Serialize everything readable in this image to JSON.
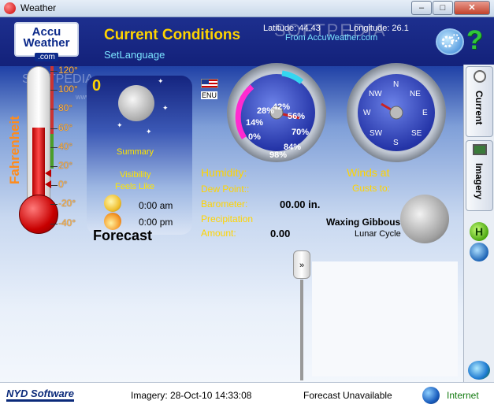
{
  "window": {
    "title": "Weather",
    "minimize_label": "–",
    "maximize_label": "□",
    "close_label": "✕"
  },
  "logo": {
    "line1": "Accu",
    "line2": "Weather",
    "line3": ".com"
  },
  "header": {
    "title": "Current Conditions",
    "set_language": "SetLanguage",
    "latitude": "Latitude: 44.43",
    "longitude": "Longitude: 26.1",
    "source": "From AccuWeather.com",
    "help_label": "?"
  },
  "thermometer": {
    "unit_label": "Fahrenheit",
    "scale": [
      "120°",
      "100°",
      "80°",
      "60°",
      "40°",
      "20°",
      "0°",
      "-20°",
      "-40°"
    ],
    "level_marker_value": 0
  },
  "summary_panel": {
    "temperature": "0",
    "summary_label": "Summary",
    "visibility_label": "Visibility",
    "feels_like_label": "Feels Like",
    "sunrise": "0:00 am",
    "sunset": "0:00 pm",
    "forecast_label": "Forecast"
  },
  "language": {
    "code": "ENU"
  },
  "humidity_gauge": {
    "labels": [
      "0%",
      "14%",
      "28%",
      "42%",
      "56%",
      "70%",
      "84%",
      "98%"
    ],
    "value_percent": 0
  },
  "wind_gauge": {
    "labels": [
      "N",
      "NE",
      "E",
      "SE",
      "S",
      "SW",
      "W",
      "NW"
    ]
  },
  "conditions": {
    "humidity_label": "Humidity:",
    "dew_point_label": "Dew Point::",
    "barometer_label": "Barometer:",
    "barometer_value": "00.00 in.",
    "precipitation_label": "Precipitation",
    "amount_label": "Amount:",
    "amount_value": "0.00",
    "winds_at_label": "Winds at",
    "gusts_label": "Gusts to:"
  },
  "moon": {
    "phase": "Waxing Gibbous",
    "cycle_label": "Lunar Cycle"
  },
  "expander": {
    "label": "»"
  },
  "tabs": [
    {
      "label": "Current"
    },
    {
      "label": "Imagery"
    }
  ],
  "side_icons": {
    "h_label": "H"
  },
  "statusbar": {
    "brand": "NYD Software",
    "imagery": "Imagery: 28-Oct-10 14:33:08",
    "forecast": "Forecast Unavailable",
    "connection": "Internet"
  },
  "watermark": {
    "text": "SOFTPEDIA",
    "url": "www.softpedia.com"
  },
  "colors": {
    "title_yellow": "#ffd400",
    "link_cyan": "#7be3ff",
    "header_blue": "#13217a",
    "help_green": "#2fc83a"
  }
}
